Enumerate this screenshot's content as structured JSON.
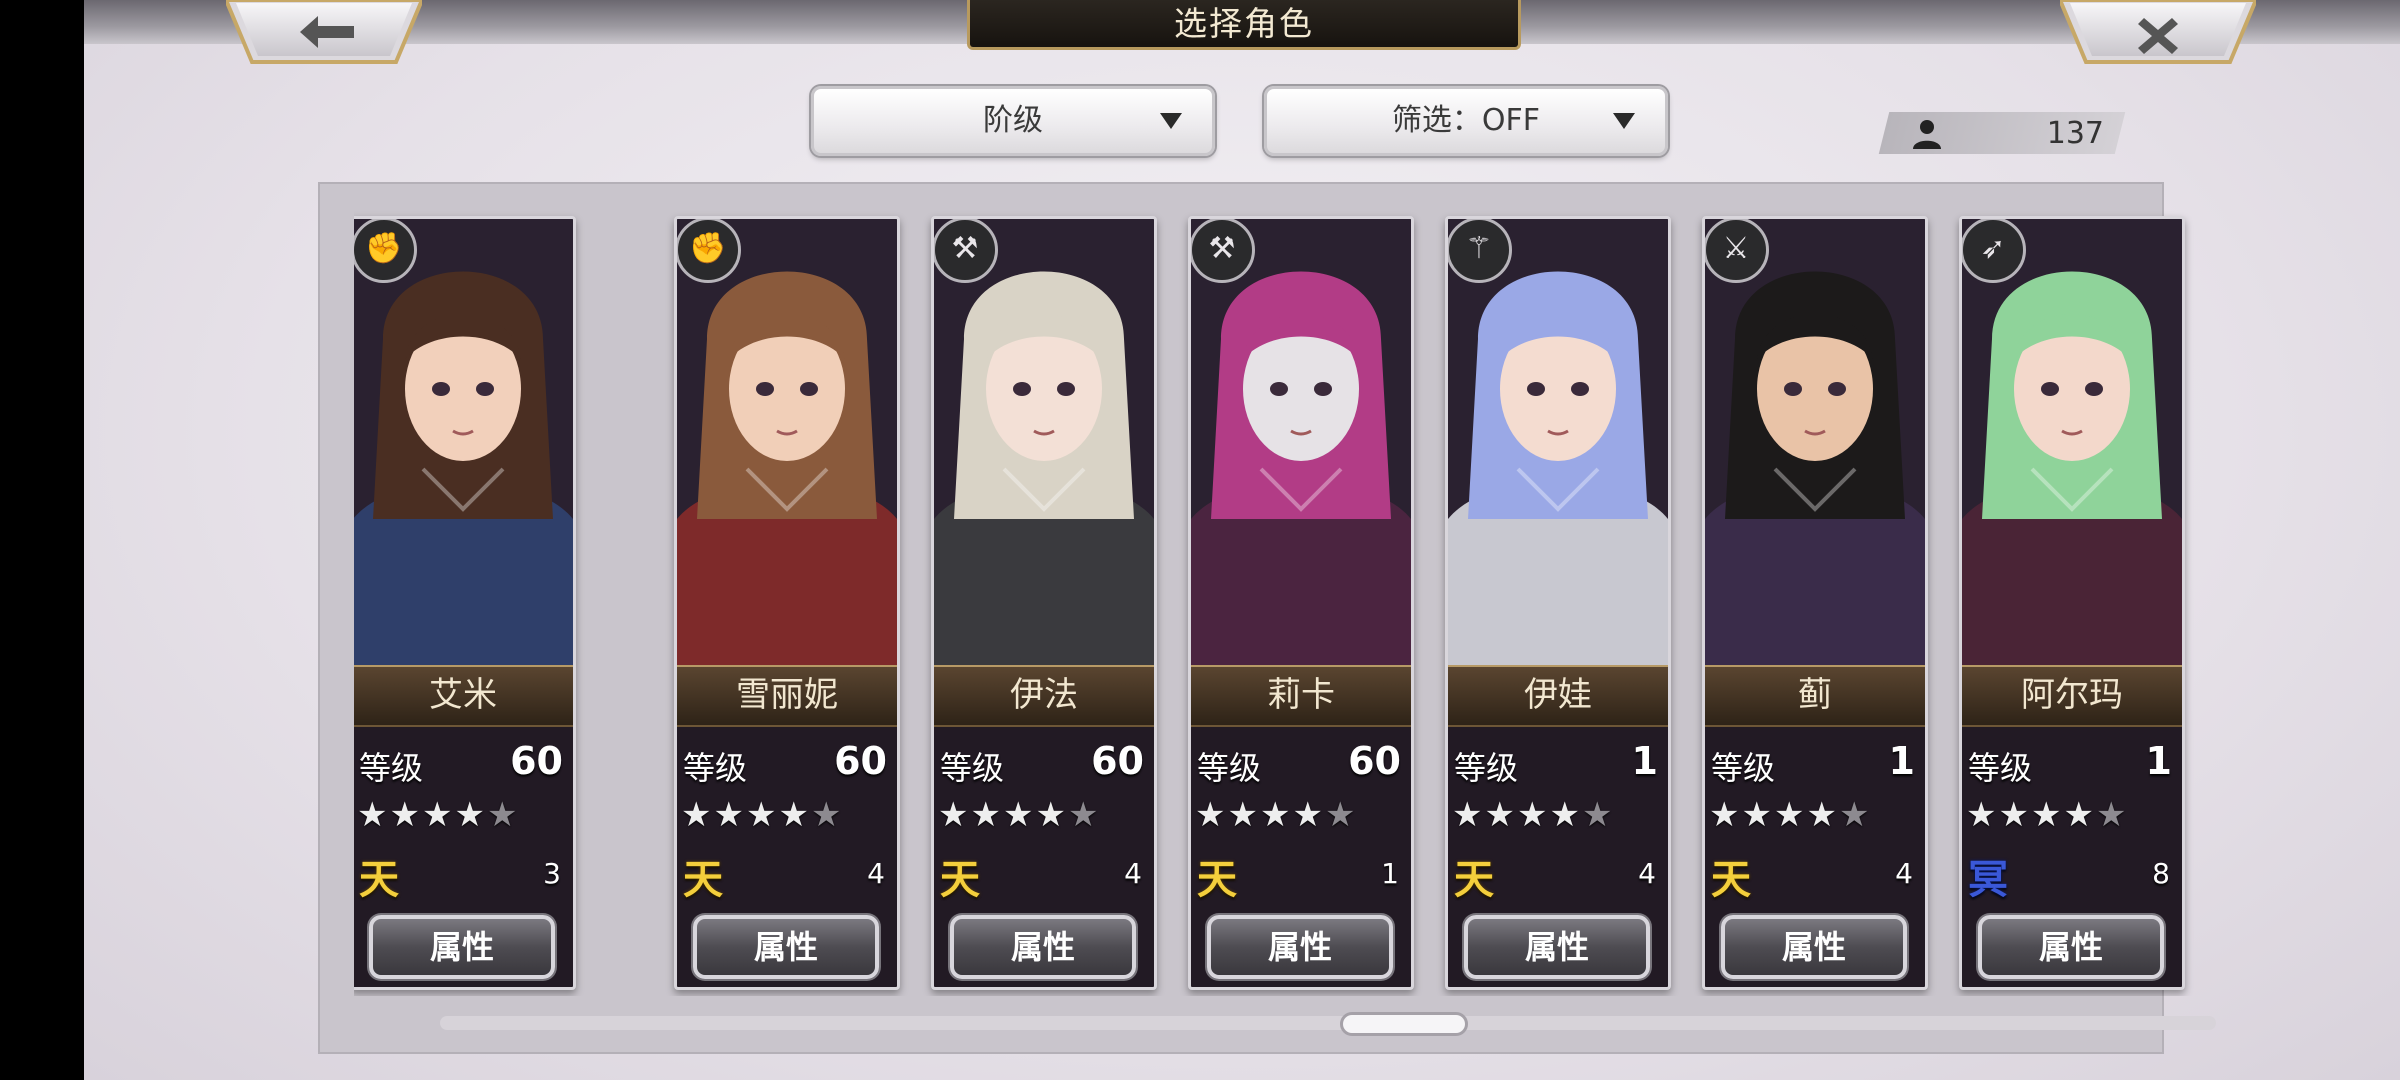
{
  "header": {
    "title": "选择角色",
    "back_icon": "back-arrow-icon",
    "close_icon": "close-x-icon"
  },
  "filters": {
    "sort_label": "阶级",
    "filter_label": "筛选：OFF"
  },
  "roster": {
    "count": "137"
  },
  "cards": [
    {
      "name": "艾米",
      "level_label": "等级",
      "level": "60",
      "stars_filled": 4,
      "stars_total": 5,
      "rank_glyph": "天",
      "rank_color": "#f4cf3c",
      "rank_num": "3",
      "button": "属性",
      "weapon_icon": "gauntlet-icon",
      "hair": "#4a2e22",
      "skin": "#f2d0bb",
      "outfit": "#2f3f6a"
    },
    {
      "name": "雪丽妮",
      "level_label": "等级",
      "level": "60",
      "stars_filled": 4,
      "stars_total": 5,
      "rank_glyph": "天",
      "rank_color": "#f4cf3c",
      "rank_num": "4",
      "button": "属性",
      "weapon_icon": "gauntlet-icon",
      "hair": "#8a5a3c",
      "skin": "#f1cfb8",
      "outfit": "#7e2a2a"
    },
    {
      "name": "伊法",
      "level_label": "等级",
      "level": "60",
      "stars_filled": 4,
      "stars_total": 5,
      "rank_glyph": "天",
      "rank_color": "#f4cf3c",
      "rank_num": "4",
      "button": "属性",
      "weapon_icon": "hammer-icon",
      "hair": "#d9d3c6",
      "skin": "#f3e0d6",
      "outfit": "#3a3a3e"
    },
    {
      "name": "莉卡",
      "level_label": "等级",
      "level": "60",
      "stars_filled": 4,
      "stars_total": 5,
      "rank_glyph": "天",
      "rank_color": "#f4cf3c",
      "rank_num": "1",
      "button": "属性",
      "weapon_icon": "hammer-icon",
      "hair": "#b23c86",
      "skin": "#e6e2e6",
      "outfit": "#4b2440"
    },
    {
      "name": "伊娃",
      "level_label": "等级",
      "level": "1",
      "stars_filled": 4,
      "stars_total": 5,
      "rank_glyph": "天",
      "rank_color": "#f4cf3c",
      "rank_num": "4",
      "button": "属性",
      "weapon_icon": "staff-icon",
      "hair": "#9aa8e6",
      "skin": "#f4dcd0",
      "outfit": "#c8c8d0"
    },
    {
      "name": "蓟",
      "level_label": "等级",
      "level": "1",
      "stars_filled": 4,
      "stars_total": 5,
      "rank_glyph": "天",
      "rank_color": "#f4cf3c",
      "rank_num": "4",
      "button": "属性",
      "weapon_icon": "sword-icon",
      "hair": "#1c1a1a",
      "skin": "#e9c3a7",
      "outfit": "#3a2c4a"
    },
    {
      "name": "阿尔玛",
      "level_label": "等级",
      "level": "1",
      "stars_filled": 4,
      "stars_total": 5,
      "rank_glyph": "冥",
      "rank_color": "#3a58d8",
      "rank_num": "8",
      "button": "属性",
      "weapon_icon": "bow-icon",
      "hair": "#8fd39a",
      "skin": "#f3d8cb",
      "outfit": "#4a2436"
    }
  ],
  "scroll": {
    "position": 0.5
  }
}
